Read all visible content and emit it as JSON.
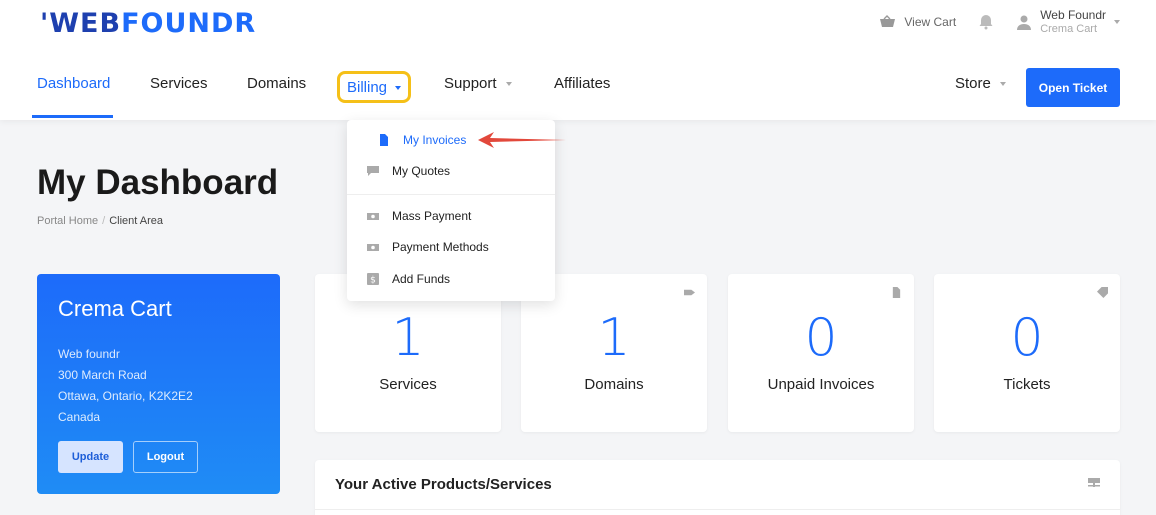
{
  "brand": {
    "logo_left": "'WEB",
    "logo_right": "FOUNDR",
    "color": "#1d6bfa"
  },
  "topbar": {
    "view_cart": "View Cart",
    "user_name": "Web Foundr",
    "user_company": "Crema Cart"
  },
  "nav": {
    "items": [
      "Dashboard",
      "Services",
      "Domains",
      "Billing",
      "Support",
      "Affiliates"
    ],
    "active": "Dashboard",
    "store": "Store",
    "open_ticket": "Open Ticket"
  },
  "billing_menu": {
    "items": [
      {
        "label": "My Invoices",
        "icon": "file-icon",
        "highlighted": true
      },
      {
        "label": "My Quotes",
        "icon": "comment-icon"
      },
      {
        "label": "Mass Payment",
        "icon": "money-icon"
      },
      {
        "label": "Payment Methods",
        "icon": "money-icon"
      },
      {
        "label": "Add Funds",
        "icon": "funds-icon"
      }
    ]
  },
  "page": {
    "title": "My Dashboard",
    "breadcrumb": [
      "Portal Home",
      "Client Area"
    ]
  },
  "profile": {
    "name": "Crema Cart",
    "address": [
      "Web foundr",
      "300 March Road",
      "Ottawa, Ontario, K2K2E2",
      "Canada"
    ],
    "update_label": "Update",
    "logout_label": "Logout"
  },
  "stats": [
    {
      "value": "1",
      "label": "Services",
      "icon": "cube-icon"
    },
    {
      "value": "1",
      "label": "Domains",
      "icon": "tag-icon"
    },
    {
      "value": "0",
      "label": "Unpaid Invoices",
      "icon": "file-icon"
    },
    {
      "value": "0",
      "label": "Tickets",
      "icon": "ticket-icon"
    }
  ],
  "products_panel": {
    "title": "Your Active Products/Services"
  }
}
